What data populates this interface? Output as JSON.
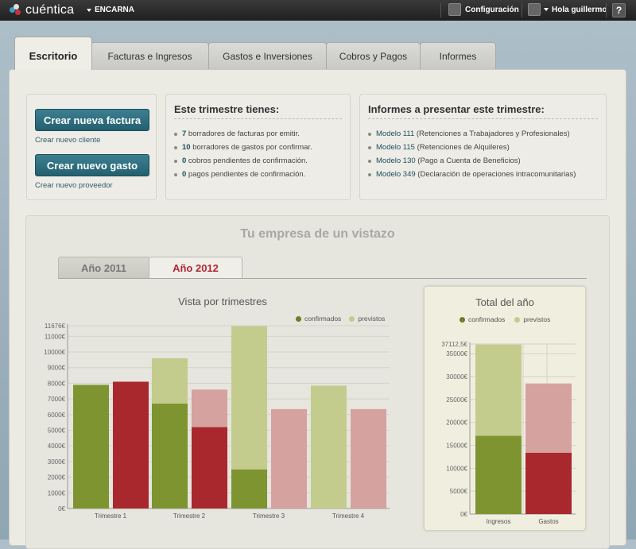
{
  "topbar": {
    "logo_text": "cuéntica",
    "company": "ENCARNA",
    "config_label": "Configuración",
    "user_label": "Hola guillermo",
    "help_label": "?"
  },
  "tabs": [
    {
      "label": "Escritorio",
      "active": true
    },
    {
      "label": "Facturas e Ingresos"
    },
    {
      "label": "Gastos e Inversiones"
    },
    {
      "label": "Cobros y Pagos"
    },
    {
      "label": "Informes"
    }
  ],
  "actions": {
    "new_invoice": "Crear nueva factura",
    "new_client": "Crear nuevo cliente",
    "new_expense": "Crear nuevo gasto",
    "new_supplier": "Crear nuevo proveedor"
  },
  "quarter": {
    "title": "Este trimestre tienes:",
    "items": [
      {
        "count": "7",
        "text": " borradores de facturas por emitir."
      },
      {
        "count": "10",
        "text": " borradores de gastos por confirmar."
      },
      {
        "count": "0",
        "text": " cobros pendientes de confirmación."
      },
      {
        "count": "0",
        "text": " pagos pendientes de confirmación."
      }
    ]
  },
  "reports": {
    "title": "Informes a presentar este trimestre:",
    "items": [
      {
        "model": "Modelo 111",
        "text": " (Retenciones a Trabajadores y Profesionales)"
      },
      {
        "model": "Modelo 115",
        "text": " (Retenciones de Alquileres)"
      },
      {
        "model": "Modelo 130",
        "text": " (Pago a Cuenta de Beneficios)"
      },
      {
        "model": "Modelo 349",
        "text": " (Declaración de operaciones intracomunitarias)"
      }
    ]
  },
  "overview": {
    "title": "Tu empresa de un vistazo",
    "year_tabs": [
      {
        "label": "Año 2011",
        "active": false
      },
      {
        "label": "Año 2012",
        "active": true
      }
    ]
  },
  "colors": {
    "income_confirmed": "#7d9430",
    "income_forecast": "#c3cc8d",
    "expense_confirmed": "#a8282e",
    "expense_forecast": "#d6a2a0"
  },
  "chart_data": [
    {
      "type": "bar",
      "title": "Vista por trimestres",
      "legend": [
        "confirmados",
        "previstos"
      ],
      "legend_position": "top-right",
      "categories": [
        "Trimestre 1",
        "Trimestre 2",
        "Trimestre 3",
        "Trimestre 4"
      ],
      "y_ticks": [
        "0€",
        "1000€",
        "2000€",
        "3000€",
        "4000€",
        "5000€",
        "6000€",
        "7000€",
        "8000€",
        "9000€",
        "10000€",
        "11000€",
        "11676€"
      ],
      "ylim": [
        0,
        11676
      ],
      "series": [
        {
          "name": "Ingresos confirmados",
          "values": [
            7900,
            6700,
            2500,
            0
          ]
        },
        {
          "name": "Ingresos previstos",
          "values": [
            0,
            2900,
            9150,
            7850
          ]
        },
        {
          "name": "Gastos confirmados",
          "values": [
            8100,
            5200,
            0,
            0
          ]
        },
        {
          "name": "Gastos previstos",
          "values": [
            0,
            2400,
            6350,
            6350
          ]
        }
      ],
      "grid": true
    },
    {
      "type": "bar",
      "title": "Total del año",
      "legend": [
        "confirmados",
        "previstos"
      ],
      "legend_position": "top",
      "categories": [
        "Ingresos",
        "Gastos"
      ],
      "y_ticks": [
        "0€",
        "5000€",
        "10000€",
        "15000€",
        "20000€",
        "25000€",
        "30000€",
        "35000€",
        "37112,5€"
      ],
      "ylim": [
        0,
        37112.5
      ],
      "series": [
        {
          "name": "confirmados",
          "values": [
            17100,
            13400
          ]
        },
        {
          "name": "previstos",
          "values": [
            19900,
            15100
          ]
        }
      ],
      "grid": true
    }
  ]
}
